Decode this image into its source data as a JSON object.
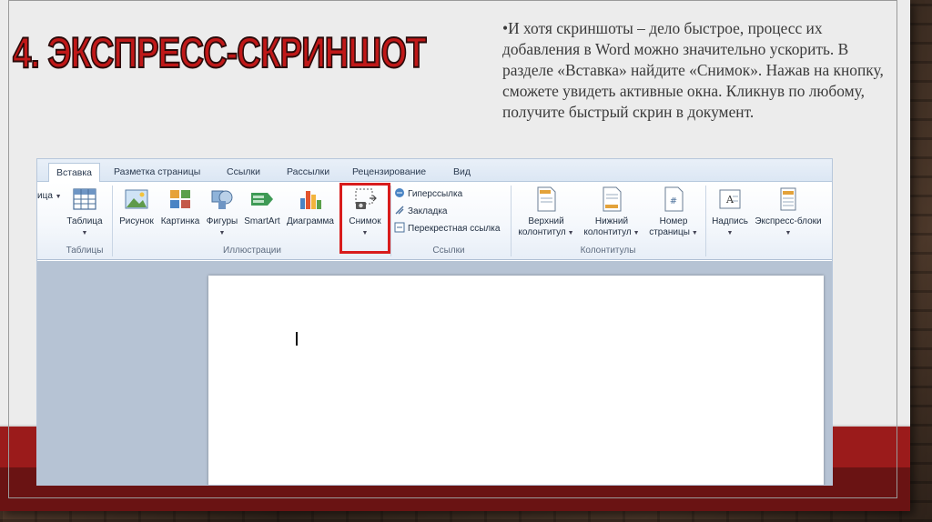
{
  "slide": {
    "title": "4. ЭКСПРЕСС-СКРИНШОТ",
    "body": "•И хотя скриншоты – дело быстрое, процесс их добавления в Word можно значительно ускорить. В разделе «Вставка» найдите «Снимок». Нажав на кнопку, сможете увидеть активные окна. Кликнув по любому, получите быстрый скрин в документ.",
    "accent_color": "#c01818",
    "band_color": "#9b1b1b"
  },
  "word": {
    "tabs": {
      "insert": "Вставка",
      "layout": "Разметка страницы",
      "references": "Ссылки",
      "mailings": "Рассылки",
      "review": "Рецензирование",
      "view": "Вид"
    },
    "partial_left_label": "ица",
    "groups": {
      "tables": "Таблицы",
      "illustrations": "Иллюстрации",
      "links": "Ссылки",
      "header_footer": "Колонтитулы"
    },
    "buttons": {
      "table": "Таблица",
      "picture": "Рисунок",
      "clipart": "Картинка",
      "shapes": "Фигуры",
      "smartart": "SmartArt",
      "chart": "Диаграмма",
      "screenshot": "Снимок",
      "hyperlink": "Гиперссылка",
      "bookmark": "Закладка",
      "crossref": "Перекрестная ссылка",
      "header_line1": "Верхний",
      "header_line2": "колонтитул",
      "footer_line1": "Нижний",
      "footer_line2": "колонтитул",
      "pagenum_line1": "Номер",
      "pagenum_line2": "страницы",
      "textbox": "Надпись",
      "quickparts": "Экспресс-блоки"
    },
    "highlight_color": "#d81c1c"
  }
}
